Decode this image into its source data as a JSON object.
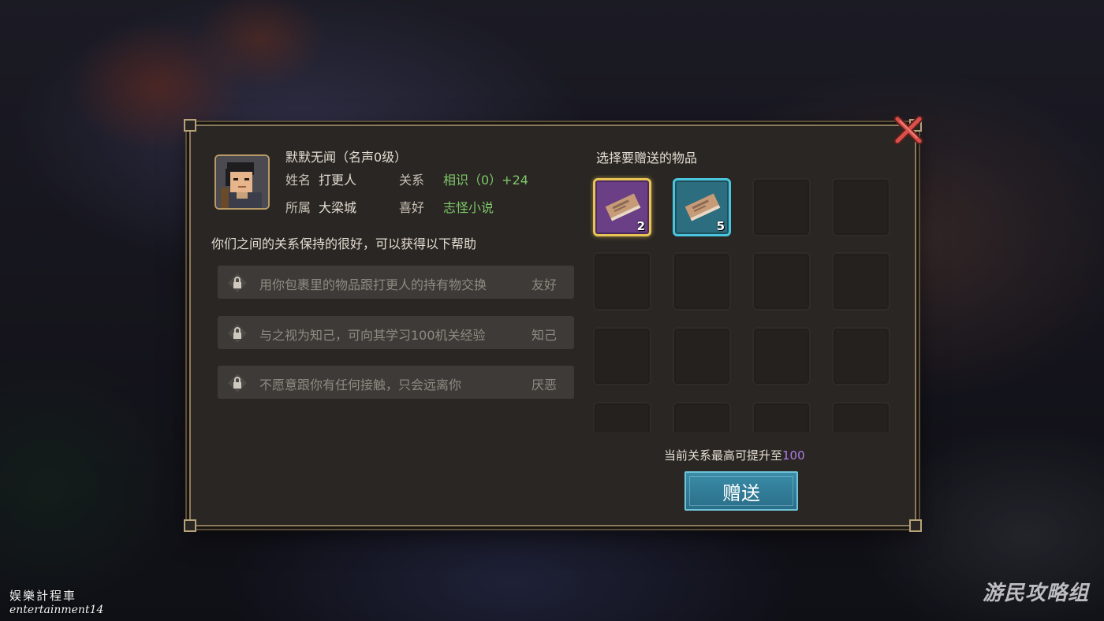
{
  "npc": {
    "title": "默默无闻（名声0级）",
    "name_label": "姓名",
    "name_value": "打更人",
    "relation_label": "关系",
    "relation_value": "相识（0）+24",
    "faction_label": "所属",
    "faction_value": "大梁城",
    "preference_label": "喜好",
    "preference_value": "志怪小说"
  },
  "relation_desc": "你们之间的关系保持的很好，可以获得以下帮助",
  "help_items": [
    {
      "text": "用你包裹里的物品跟打更人的持有物交换",
      "level": "友好"
    },
    {
      "text": "与之视为知己，可向其学习100机关经验",
      "level": "知己"
    },
    {
      "text": "不愿意跟你有任何接触，只会远离你",
      "level": "厌恶"
    }
  ],
  "gift": {
    "header": "选择要赠送的物品",
    "items": [
      {
        "icon": "book-icon",
        "rarity": "purple",
        "quantity": "2"
      },
      {
        "icon": "book-icon",
        "rarity": "cyan",
        "quantity": "5"
      }
    ],
    "max_text_prefix": "当前关系最高可提升至",
    "max_value": "100",
    "button_label": "赠送"
  },
  "colors": {
    "accent_green": "#7ec86a",
    "accent_purple": "#b07de6",
    "button_blue": "#2a6e88",
    "frame_gold": "#8c7a5c"
  },
  "watermarks": {
    "left_line1": "娱樂計程車",
    "left_line2": "entertainment14",
    "right": "游民攻略组"
  }
}
